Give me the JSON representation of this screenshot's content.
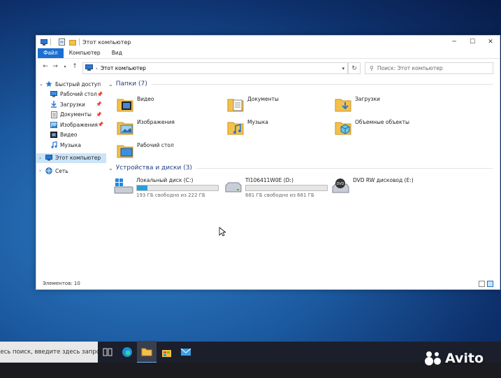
{
  "window": {
    "title": "Этот компьютер",
    "ribbon_tabs": [
      "Файл",
      "Компьютер",
      "Вид"
    ]
  },
  "address": {
    "path": "Этот компьютер",
    "search_placeholder": "Поиск: Этот компьютер"
  },
  "sidebar": {
    "quick_access": "Быстрый доступ",
    "items": [
      {
        "label": "Рабочий стол",
        "icon": "desktop-icon",
        "pinned": true
      },
      {
        "label": "Загрузки",
        "icon": "downloads-icon",
        "pinned": true
      },
      {
        "label": "Документы",
        "icon": "documents-icon",
        "pinned": true
      },
      {
        "label": "Изображения",
        "icon": "pictures-icon",
        "pinned": true
      },
      {
        "label": "Видео",
        "icon": "videos-icon",
        "pinned": false
      },
      {
        "label": "Музыка",
        "icon": "music-icon",
        "pinned": false
      }
    ],
    "this_pc": "Этот компьютер",
    "network": "Сеть"
  },
  "folders": {
    "header": "Папки (7)",
    "items": [
      "Видео",
      "Документы",
      "Загрузки",
      "Изображения",
      "Музыка",
      "Объемные объекты",
      "Рабочий стол"
    ]
  },
  "drives": {
    "header": "Устройства и диски (3)",
    "items": [
      {
        "name": "Локальный диск (C:)",
        "free": "193 ГБ свободно из 222 ГБ",
        "used_fraction": 0.13
      },
      {
        "name": "TI106411W0E (D:)",
        "free": "681 ГБ свободно из 681 ГБ",
        "used_fraction": 0.0
      },
      {
        "name": "DVD RW дисковод (E:)"
      }
    ]
  },
  "status": {
    "items_count": "Элементов: 10"
  },
  "taskbar": {
    "search_placeholder": "здесь поиск, введите здесь запрос"
  },
  "watermark": "Avito",
  "colors": {
    "accent": "#1a6fd1",
    "selection": "#cce4f7",
    "drive_bar": "#26a0da",
    "folder": "#f3c14b"
  }
}
